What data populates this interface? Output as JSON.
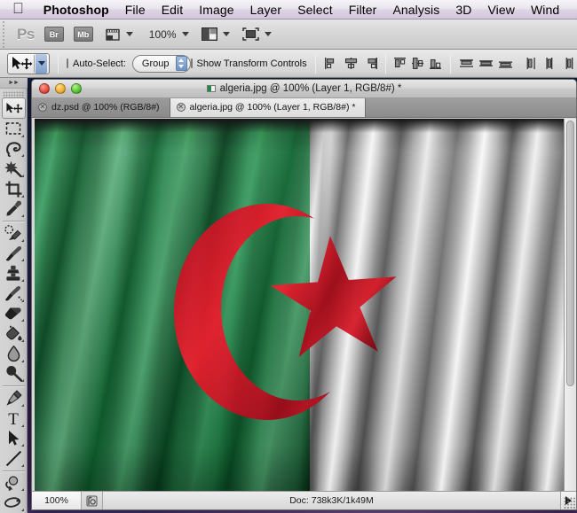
{
  "menubar": {
    "apple_icon": "apple-icon",
    "items": [
      {
        "label": "Photoshop",
        "bold": true
      },
      {
        "label": "File"
      },
      {
        "label": "Edit"
      },
      {
        "label": "Image"
      },
      {
        "label": "Layer"
      },
      {
        "label": "Select"
      },
      {
        "label": "Filter"
      },
      {
        "label": "Analysis"
      },
      {
        "label": "3D"
      },
      {
        "label": "View"
      },
      {
        "label": "Wind"
      }
    ]
  },
  "appbar": {
    "logo": "Ps",
    "bridge_label": "Br",
    "minibridge_label": "Mb",
    "view_extras_icon": "view-extras-icon",
    "zoom_level": "100%",
    "arrange_documents_icon": "arrange-documents-icon",
    "screen_mode_icon": "screen-mode-icon"
  },
  "optionsbar": {
    "tool_icon": "move-tool-icon",
    "auto_select_label": "Auto-Select:",
    "auto_select_checked": false,
    "auto_select_target": "Group",
    "show_transform_label": "Show Transform Controls",
    "show_transform_checked": false,
    "align_icons": [
      "align-left-edges-icon",
      "align-horizontal-centers-icon",
      "align-right-edges-icon",
      "align-top-edges-icon",
      "align-vertical-centers-icon",
      "align-bottom-edges-icon"
    ],
    "distribute_icons": [
      "distribute-top-edges-icon",
      "distribute-vertical-centers-icon",
      "distribute-bottom-edges-icon",
      "distribute-left-edges-icon",
      "distribute-horizontal-centers-icon",
      "distribute-right-edges-icon"
    ],
    "auto_align_icon": "auto-align-layers-icon"
  },
  "tools": {
    "collapse_icon": "collapse-panel-icon",
    "items": [
      {
        "name": "move-tool",
        "selected": true,
        "has_flyout": false,
        "divider_after": false
      },
      {
        "name": "rectangular-marquee-tool",
        "selected": false,
        "has_flyout": true,
        "divider_after": false
      },
      {
        "name": "lasso-tool",
        "selected": false,
        "has_flyout": true,
        "divider_after": false
      },
      {
        "name": "magic-wand-tool",
        "selected": false,
        "has_flyout": true,
        "divider_after": false
      },
      {
        "name": "crop-tool",
        "selected": false,
        "has_flyout": true,
        "divider_after": false
      },
      {
        "name": "eyedropper-tool",
        "selected": false,
        "has_flyout": true,
        "divider_after": true
      },
      {
        "name": "spot-healing-brush-tool",
        "selected": false,
        "has_flyout": true,
        "divider_after": false
      },
      {
        "name": "brush-tool",
        "selected": false,
        "has_flyout": true,
        "divider_after": false
      },
      {
        "name": "clone-stamp-tool",
        "selected": false,
        "has_flyout": true,
        "divider_after": false
      },
      {
        "name": "history-brush-tool",
        "selected": false,
        "has_flyout": true,
        "divider_after": false
      },
      {
        "name": "eraser-tool",
        "selected": false,
        "has_flyout": true,
        "divider_after": false
      },
      {
        "name": "paint-bucket-tool",
        "selected": false,
        "has_flyout": true,
        "divider_after": false
      },
      {
        "name": "blur-tool",
        "selected": false,
        "has_flyout": true,
        "divider_after": false
      },
      {
        "name": "dodge-tool",
        "selected": false,
        "has_flyout": true,
        "divider_after": true
      },
      {
        "name": "pen-tool",
        "selected": false,
        "has_flyout": true,
        "divider_after": false
      },
      {
        "name": "horizontal-type-tool",
        "selected": false,
        "has_flyout": true,
        "divider_after": false
      },
      {
        "name": "path-selection-tool",
        "selected": false,
        "has_flyout": true,
        "divider_after": false
      },
      {
        "name": "line-tool",
        "selected": false,
        "has_flyout": true,
        "divider_after": true
      },
      {
        "name": "3d-rotate-tool",
        "selected": false,
        "has_flyout": true,
        "divider_after": false
      },
      {
        "name": "3d-orbit-tool",
        "selected": false,
        "has_flyout": true,
        "divider_after": false
      }
    ]
  },
  "document_window": {
    "title": "algeria.jpg @ 100% (Layer 1, RGB/8#) *",
    "document_icon": "algeria-document-icon",
    "close_button": "close-window-button",
    "minimize_button": "minimize-window-button",
    "zoom_button": "zoom-window-button",
    "tabs": [
      {
        "label": "dz.psd @ 100% (RGB/8#)",
        "active": false,
        "close_icon": "close-tab-icon"
      },
      {
        "label": "algeria.jpg @ 100% (Layer 1, RGB/8#) *",
        "active": true,
        "close_icon": "close-tab-icon"
      }
    ],
    "statusbar": {
      "zoom_value": "100%",
      "preview_icon": "document-preview-icon",
      "doc_info": "Doc: 738k3K/1k49M",
      "more_icon": "status-more-icon"
    },
    "scrollbar": {
      "vertical_thumb": "vertical-scroll-thumb",
      "resize_grip": "window-resize-grip"
    }
  },
  "canvas": {
    "image_name": "algeria-flag-image",
    "description": "Waving Algerian flag silk texture, left half green, right half desaturated grayscale, red crescent and star at center",
    "colors": {
      "green": "#0d8a3e",
      "red": "#cc1122",
      "gray": "#b9b9b9",
      "white": "#f4f4f4"
    }
  }
}
